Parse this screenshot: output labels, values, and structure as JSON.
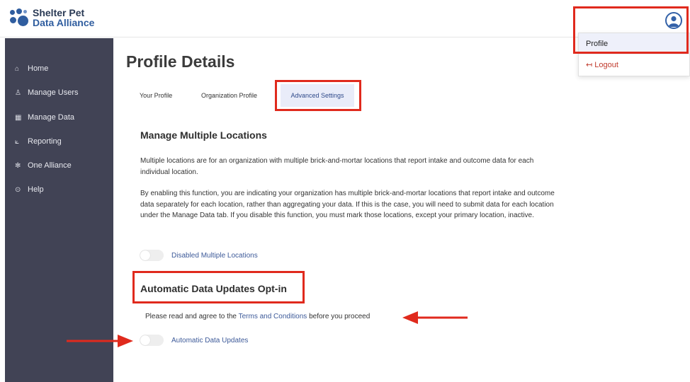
{
  "brand": {
    "line1": "Shelter Pet",
    "line2": "Data Alliance"
  },
  "user_menu": {
    "profile_label": "Profile",
    "logout_label": "Logout",
    "logout_icon": "↤"
  },
  "sidebar": {
    "items": [
      {
        "label": "Home",
        "icon": "⌂"
      },
      {
        "label": "Manage Users",
        "icon": "♙"
      },
      {
        "label": "Manage Data",
        "icon": "▦"
      },
      {
        "label": "Reporting",
        "icon": "⟀"
      },
      {
        "label": "One Alliance",
        "icon": "✻"
      },
      {
        "label": "Help",
        "icon": "⊙"
      }
    ]
  },
  "page": {
    "title": "Profile Details",
    "tabs": [
      "Your Profile",
      "Organization Profile",
      "Advanced Settings"
    ],
    "active_tab": "Advanced Settings"
  },
  "multiple_locations": {
    "title": "Manage Multiple Locations",
    "para1": "Multiple locations are for an organization with multiple brick-and-mortar locations that report intake and outcome data for each individual location.",
    "para2": "By enabling this function, you are indicating your organization has multiple brick-and-mortar locations that report intake and outcome data separately for each location, rather than aggregating your data. If this is the case, you will need to submit data for each location under the Manage Data tab. If you disable this function, you must mark those locations, except your primary location, inactive.",
    "toggle_label": "Disabled Multiple Locations"
  },
  "auto_updates": {
    "title": "Automatic Data Updates Opt-in",
    "agree_prefix": "Please read and agree to the ",
    "agree_link": "Terms and Conditions",
    "agree_suffix": " before you proceed",
    "toggle_label": "Automatic Data Updates"
  },
  "colors": {
    "sidebar": "#414355",
    "accent": "#3361a8",
    "annotation": "#e02a1d"
  }
}
